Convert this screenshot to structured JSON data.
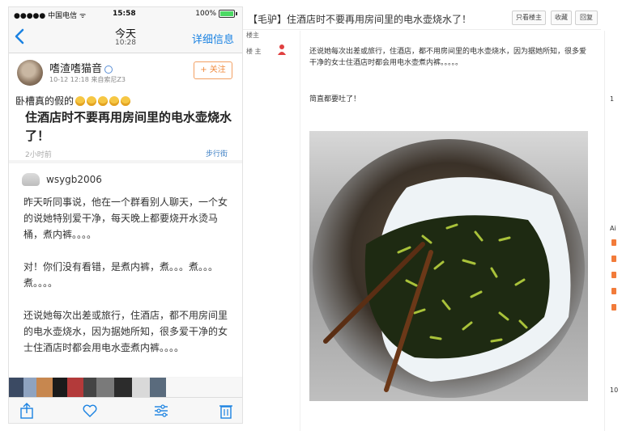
{
  "phone": {
    "status": {
      "carrier": "●●●●● 中国电信 ᯤ",
      "time": "15:58",
      "battery": "100%"
    },
    "nav": {
      "title": "今天",
      "subtitle": "10:28",
      "detail": "详细信息"
    },
    "post": {
      "username": "嗜渣嗜猫音",
      "meta": "10-12 12:18  来自索尼Z3",
      "follow": "+ 关注",
      "teaser": "卧槽真的假的",
      "headline": "住酒店时不要再用房间里的电水壶烧水了！",
      "time": "2小时前",
      "street": "步行街"
    },
    "comment": {
      "user": "wsygb2006",
      "body": "昨天听同事说，他在一个群看别人聊天，一个女的说她特别爱干净，每天晚上都要烧开水烫马桶，煮内裤。。。。\n\n对！你们没有看错，是煮内裤，煮。。。煮。。。煮。。。。\n\n还说她每次出差或旅行，住酒店，都不用房间里的电水壶烧水，因为据她所知，很多爱干净的女士住酒店时都会用电水壶煮内裤。。。。"
    },
    "tabs": [
      "share-icon",
      "heart-icon",
      "sliders-icon",
      "trash-icon"
    ]
  },
  "web": {
    "title": "【毛驴】住酒店时不要再用房间里的电水壶烧水了！",
    "buttons": [
      "只看楼主",
      "收藏",
      "回复"
    ],
    "left_small": "楼主",
    "left_label": "楼 主",
    "para1": "还说她每次出差或旅行，住酒店，都不用房间里的电水壶烧水，因为据她所知，很多爱干净的女士住酒店时都会用电水壶煮内裤。。。。。",
    "para2": "简直都要吐了！",
    "edge": [
      "1",
      "Ai",
      "10"
    ]
  },
  "colors": {
    "link_blue": "#1a82e2",
    "follow_orange": "#f08a3c",
    "battery_green": "#4cd964"
  }
}
